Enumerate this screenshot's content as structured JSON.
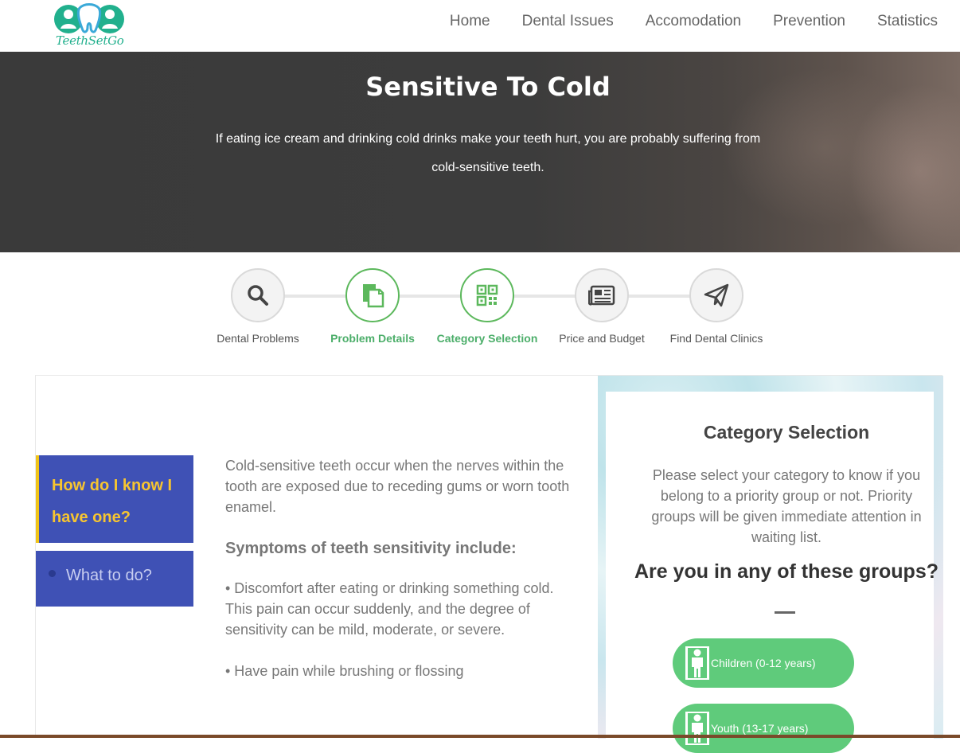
{
  "brand": {
    "name": "TeethSetGo",
    "color": "#21b08d"
  },
  "nav": {
    "items": [
      "Home",
      "Dental Issues",
      "Accomodation",
      "Prevention",
      "Statistics"
    ]
  },
  "hero": {
    "title": "Sensitive To Cold",
    "text": "If eating ice cream and drinking cold drinks make your teeth hurt, you are probably suffering from cold-sensitive teeth."
  },
  "steps": [
    {
      "label": "Dental Problems",
      "icon": "search-icon",
      "active": false
    },
    {
      "label": "Problem Details",
      "icon": "document-icon",
      "active": true
    },
    {
      "label": "Category Selection",
      "icon": "qr-code-icon",
      "active": true
    },
    {
      "label": "Price and Budget",
      "icon": "newspaper-icon",
      "active": false
    },
    {
      "label": "Find Dental Clinics",
      "icon": "paper-plane-icon",
      "active": false
    }
  ],
  "tabs": {
    "how_line1": "How do I know I",
    "how_line2": "have one?",
    "what": "What to do?"
  },
  "content": {
    "intro": "Cold-sensitive teeth occur when the nerves within the tooth are exposed due to receding gums or worn tooth enamel.",
    "heading": "Symptoms of teeth sensitivity include:",
    "bullet1": "• Discomfort after eating or drinking something cold. This pain can occur suddenly, and the degree of sensitivity can be mild, moderate, or severe.",
    "bullet2": "• Have pain while brushing or flossing"
  },
  "panel": {
    "title": "Category Selection",
    "text": "Please select your category to know if you belong to a priority group or not. Priority groups will be given immediate attention in waiting list.",
    "question": "Are you in any of these groups?",
    "groups": [
      "Children (0-12 years)",
      "Youth (13-17 years)"
    ]
  },
  "colors": {
    "tab_bg": "#3f51b5",
    "tab_active_text": "#f7c530",
    "green": "#5fcb7b",
    "step_active": "#4cae6a"
  }
}
